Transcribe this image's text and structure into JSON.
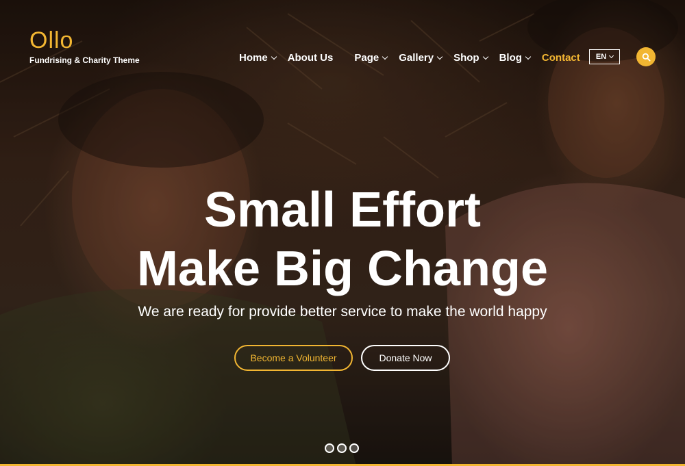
{
  "logo": {
    "name": "Ollo",
    "tagline": "Fundrising & Charity Theme"
  },
  "nav": {
    "items": [
      {
        "label": "Home",
        "has_dropdown": true
      },
      {
        "label": "About Us",
        "has_dropdown": false
      },
      {
        "label": "Page",
        "has_dropdown": true
      },
      {
        "label": "Gallery",
        "has_dropdown": true
      },
      {
        "label": "Shop",
        "has_dropdown": true
      },
      {
        "label": "Blog",
        "has_dropdown": true
      },
      {
        "label": "Contact",
        "has_dropdown": false,
        "active": true
      }
    ],
    "language": "EN",
    "search_icon": "search-icon"
  },
  "hero": {
    "headline_line1": "Small Effort",
    "headline_line2": "Make Big Change",
    "subtitle": "We are ready for provide better service to make the world happy",
    "volunteer_button": "Become a Volunteer",
    "donate_button": "Donate Now",
    "slides_count": 3
  },
  "colors": {
    "accent": "#f2b632",
    "text": "#ffffff"
  }
}
